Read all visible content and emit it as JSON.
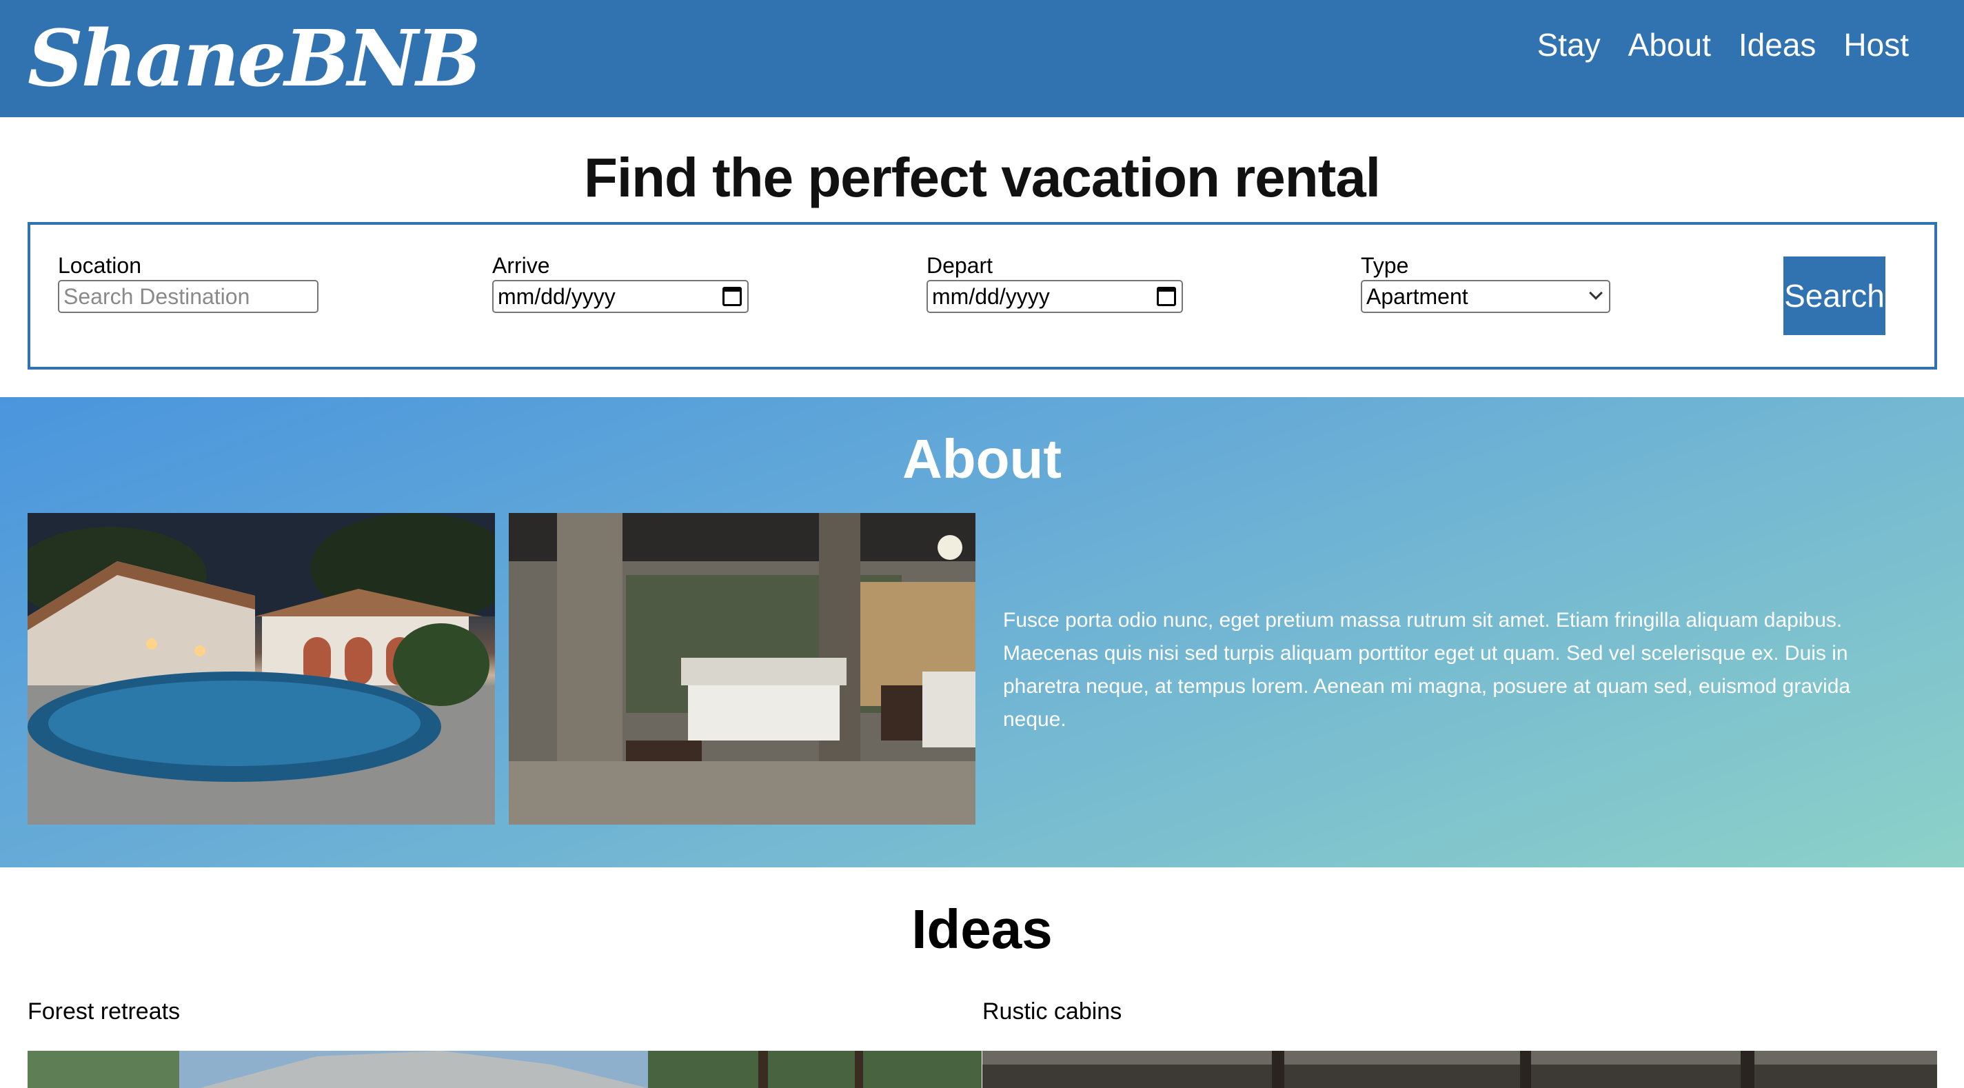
{
  "header": {
    "logo": "ShaneBNB",
    "nav": [
      "Stay",
      "About",
      "Ideas",
      "Host"
    ]
  },
  "hero": {
    "title": "Find the perfect vacation rental"
  },
  "search": {
    "location": {
      "label": "Location",
      "placeholder": "Search Destination"
    },
    "arrive": {
      "label": "Arrive",
      "value": "mm/dd/yyyy"
    },
    "depart": {
      "label": "Depart",
      "value": "mm/dd/yyyy"
    },
    "type": {
      "label": "Type",
      "selected": "Apartment"
    },
    "button": "Search"
  },
  "about": {
    "title": "About",
    "text": "Fusce porta odio nunc, eget pretium massa rutrum sit amet. Etiam fringilla aliquam dapibus. Maecenas quis nisi sed turpis aliquam porttitor eget ut quam. Sed vel scelerisque ex. Duis in pharetra neque, at tempus lorem. Aenean mi magna, posuere at quam sed, euismod gravida neque."
  },
  "ideas": {
    "title": "Ideas",
    "items": [
      {
        "label": "Forest retreats"
      },
      {
        "label": "Rustic cabins"
      }
    ]
  },
  "colors": {
    "brand": "#3173b1",
    "gradient_start": "#4a95dd",
    "gradient_end": "#8dd1c8"
  }
}
